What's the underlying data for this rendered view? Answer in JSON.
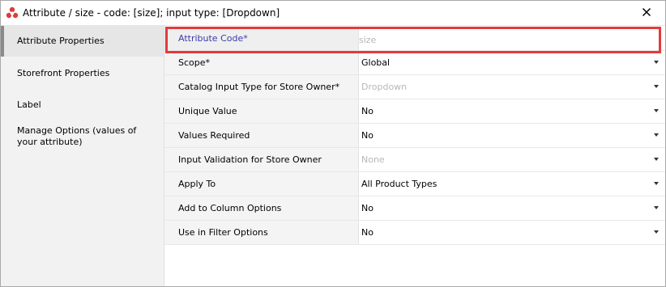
{
  "window": {
    "title": "Attribute / size - code: [size]; input type: [Dropdown]",
    "close_glyph": "✕",
    "icon": "app-logo-icon",
    "accent_color": "#e23b3b"
  },
  "sidebar": {
    "items": [
      {
        "label": "Attribute Properties",
        "active": true
      },
      {
        "label": "Storefront Properties",
        "active": false
      },
      {
        "label": "Label",
        "active": false
      },
      {
        "label": "Manage Options (values of your attribute)",
        "active": false
      }
    ]
  },
  "properties": [
    {
      "label": "Attribute Code*",
      "value": "size",
      "disabled": true,
      "dropdown": false,
      "selected": true
    },
    {
      "label": "Scope*",
      "value": "Global",
      "disabled": false,
      "dropdown": true
    },
    {
      "label": "Catalog Input Type for Store Owner*",
      "value": "Dropdown",
      "disabled": true,
      "dropdown": true
    },
    {
      "label": "Unique Value",
      "value": "No",
      "disabled": false,
      "dropdown": true
    },
    {
      "label": "Values Required",
      "value": "No",
      "disabled": false,
      "dropdown": true
    },
    {
      "label": "Input Validation for Store Owner",
      "value": "None",
      "disabled": true,
      "dropdown": true
    },
    {
      "label": "Apply To",
      "value": "All Product Types",
      "disabled": false,
      "dropdown": true
    },
    {
      "label": "Add to Column Options",
      "value": "No",
      "disabled": false,
      "dropdown": true
    },
    {
      "label": "Use in Filter Options",
      "value": "No",
      "disabled": false,
      "dropdown": true
    }
  ]
}
